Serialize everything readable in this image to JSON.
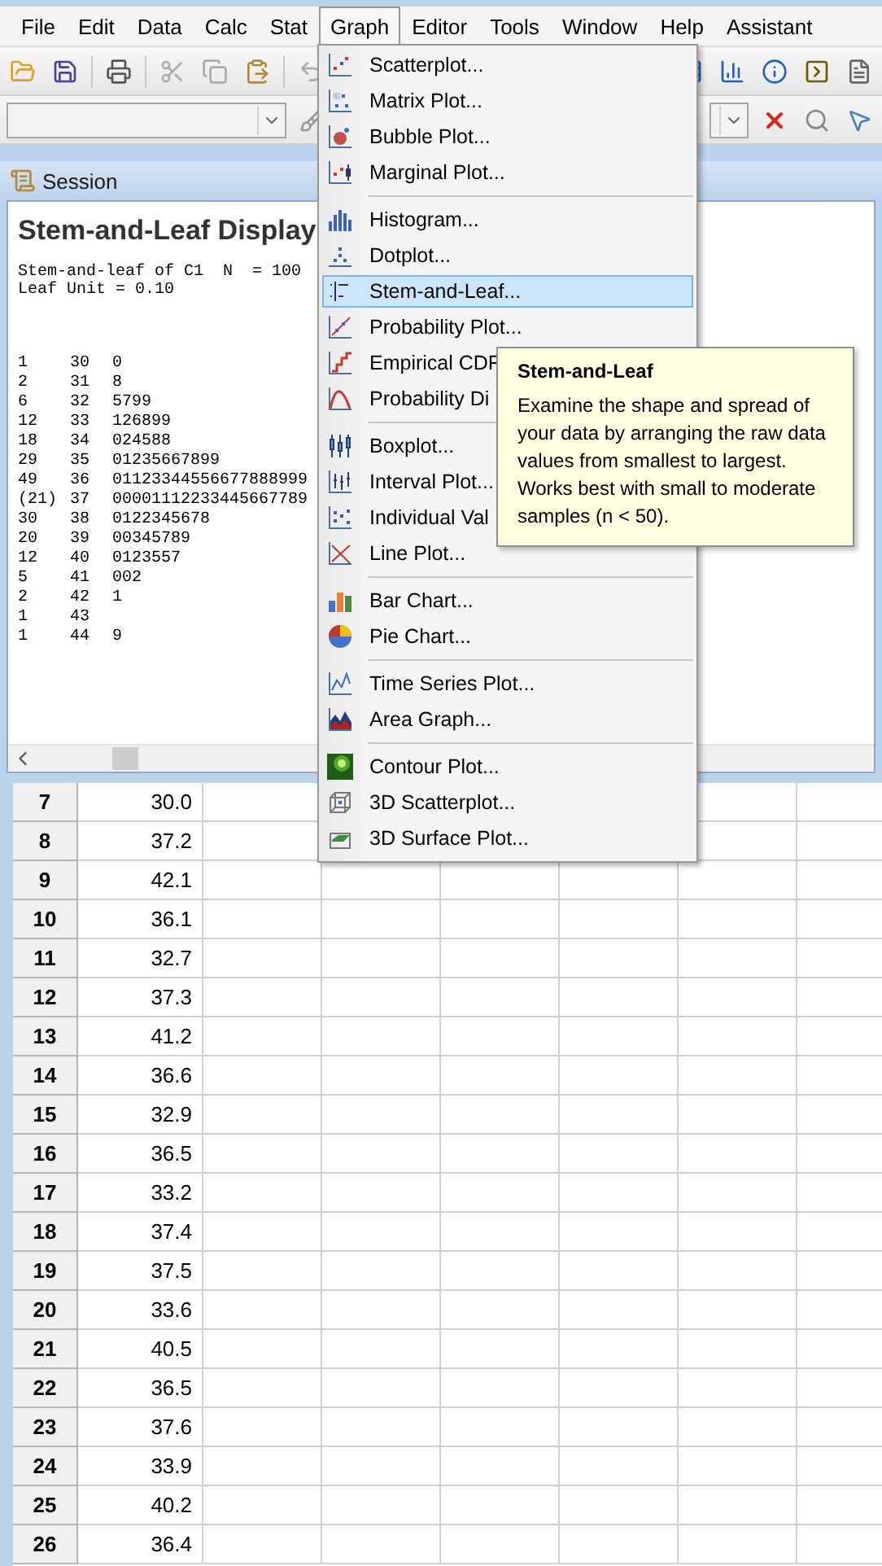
{
  "menubar": [
    {
      "label": "File",
      "selected": false
    },
    {
      "label": "Edit",
      "selected": false
    },
    {
      "label": "Data",
      "selected": false
    },
    {
      "label": "Calc",
      "selected": false
    },
    {
      "label": "Stat",
      "selected": false
    },
    {
      "label": "Graph",
      "selected": true
    },
    {
      "label": "Editor",
      "selected": false
    },
    {
      "label": "Tools",
      "selected": false
    },
    {
      "label": "Window",
      "selected": false
    },
    {
      "label": "Help",
      "selected": false
    },
    {
      "label": "Assistant",
      "selected": false
    }
  ],
  "session": {
    "title": "Session",
    "heading": "Stem-and-Leaf Display",
    "lines": [
      "Stem-and-leaf of C1  N  = 100",
      "Leaf Unit = 0.10"
    ],
    "rows": [
      [
        "1",
        "30",
        "0"
      ],
      [
        "2",
        "31",
        "8"
      ],
      [
        "6",
        "32",
        "5799"
      ],
      [
        "12",
        "33",
        "126899"
      ],
      [
        "18",
        "34",
        "024588"
      ],
      [
        "29",
        "35",
        "01235667899"
      ],
      [
        "49",
        "36",
        "01123344556677888999"
      ],
      [
        "(21)",
        "37",
        "00001112233445667789"
      ],
      [
        "30",
        "38",
        "0122345678"
      ],
      [
        "20",
        "39",
        "00345789"
      ],
      [
        "12",
        "40",
        "0123557"
      ],
      [
        "5",
        "41",
        "002"
      ],
      [
        "2",
        "42",
        "1"
      ],
      [
        "1",
        "43",
        ""
      ],
      [
        "1",
        "44",
        "9"
      ]
    ]
  },
  "graph_menu": {
    "items": [
      {
        "kind": "item",
        "label": "Scatterplot...",
        "selected": false
      },
      {
        "kind": "item",
        "label": "Matrix Plot...",
        "selected": false
      },
      {
        "kind": "item",
        "label": "Bubble Plot...",
        "selected": false
      },
      {
        "kind": "item",
        "label": "Marginal Plot...",
        "selected": false
      },
      {
        "kind": "separator"
      },
      {
        "kind": "item",
        "label": "Histogram...",
        "selected": false
      },
      {
        "kind": "item",
        "label": "Dotplot...",
        "selected": false
      },
      {
        "kind": "item",
        "label": "Stem-and-Leaf...",
        "selected": true
      },
      {
        "kind": "item",
        "label": "Probability Plot...",
        "selected": false
      },
      {
        "kind": "item",
        "label": "Empirical CDF",
        "selected": false
      },
      {
        "kind": "item",
        "label": "Probability Di",
        "selected": false
      },
      {
        "kind": "separator"
      },
      {
        "kind": "item",
        "label": "Boxplot...",
        "selected": false
      },
      {
        "kind": "item",
        "label": "Interval Plot...",
        "selected": false
      },
      {
        "kind": "item",
        "label": "Individual Val",
        "selected": false
      },
      {
        "kind": "item",
        "label": "Line Plot...",
        "selected": false
      },
      {
        "kind": "separator"
      },
      {
        "kind": "item",
        "label": "Bar Chart...",
        "selected": false
      },
      {
        "kind": "item",
        "label": "Pie Chart...",
        "selected": false
      },
      {
        "kind": "separator"
      },
      {
        "kind": "item",
        "label": "Time Series Plot...",
        "selected": false
      },
      {
        "kind": "item",
        "label": "Area Graph...",
        "selected": false
      },
      {
        "kind": "separator"
      },
      {
        "kind": "item",
        "label": "Contour Plot...",
        "selected": false
      },
      {
        "kind": "item",
        "label": "3D Scatterplot...",
        "selected": false
      },
      {
        "kind": "item",
        "label": "3D Surface Plot...",
        "selected": false
      }
    ]
  },
  "tooltip": {
    "title": "Stem-and-Leaf",
    "text": "Examine the shape and spread of your data by arranging the raw data values from smallest to largest. Works best with small to moderate samples (n < 50)."
  },
  "worksheet": {
    "rows": [
      {
        "row": "7",
        "c1": "30.0"
      },
      {
        "row": "8",
        "c1": "37.2"
      },
      {
        "row": "9",
        "c1": "42.1"
      },
      {
        "row": "10",
        "c1": "36.1"
      },
      {
        "row": "11",
        "c1": "32.7"
      },
      {
        "row": "12",
        "c1": "37.3"
      },
      {
        "row": "13",
        "c1": "41.2"
      },
      {
        "row": "14",
        "c1": "36.6"
      },
      {
        "row": "15",
        "c1": "32.9"
      },
      {
        "row": "16",
        "c1": "36.5"
      },
      {
        "row": "17",
        "c1": "33.2"
      },
      {
        "row": "18",
        "c1": "37.4"
      },
      {
        "row": "19",
        "c1": "37.5"
      },
      {
        "row": "20",
        "c1": "33.6"
      },
      {
        "row": "21",
        "c1": "40.5"
      },
      {
        "row": "22",
        "c1": "36.5"
      },
      {
        "row": "23",
        "c1": "37.6"
      },
      {
        "row": "24",
        "c1": "33.9"
      },
      {
        "row": "25",
        "c1": "40.2"
      },
      {
        "row": "26",
        "c1": "36.4"
      }
    ]
  }
}
